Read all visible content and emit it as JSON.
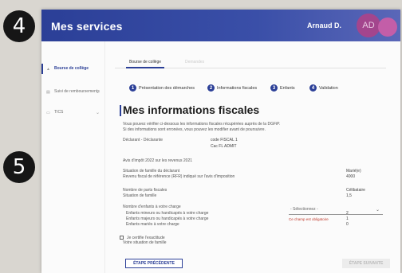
{
  "callouts": {
    "first": "4",
    "second": "5"
  },
  "header": {
    "title": "Mes services",
    "user_name": "Arnaud D.",
    "avatar_initials": "AD"
  },
  "sidebar": {
    "items": [
      {
        "label": "Bourse de collège",
        "icon": "graduation-cap-icon"
      },
      {
        "label": "Suivi de remboursements",
        "icon": "receipt-icon"
      },
      {
        "label": "TICS",
        "icon": "card-icon"
      }
    ]
  },
  "tabs": [
    {
      "label": "Bourse de collège"
    },
    {
      "label": "Demandes"
    }
  ],
  "stepper": [
    {
      "num": "1",
      "label": "Présentation des démarches"
    },
    {
      "num": "2",
      "label": "Informations fiscales"
    },
    {
      "num": "3",
      "label": "Enfants"
    },
    {
      "num": "4",
      "label": "Validation"
    }
  ],
  "main": {
    "title": "Mes informations fiscales",
    "intro_line1": "Vous pouvez vérifier ci-dessous les informations fiscales récupérées auprès de la DGFiP.",
    "intro_line2": "Si des informations sont erronées, vous pouvez les modifier avant de poursuivre.",
    "declarant_label": "Déclarant - Déclarante",
    "declarant_value1": "code FISCAL 1",
    "declarant_value2": "Cac FL ADMIT",
    "year_line": "Avis d'impôt 2022 sur les revenus 2021",
    "situation_label": "Situation de famille du déclarant",
    "situation_value": "Marié(e)",
    "income_label": "Revenu fiscal de référence (RFR) indiqué sur l'avis d'imposition",
    "income_value": "4000",
    "parts_label": "Nombre de parts fiscales",
    "parts_value": "Célibataire",
    "parts_detail": "Situation de famille",
    "parts_detail_value": "1,5",
    "children_label": "Nombre d'enfants à votre charge",
    "children_row1": "Enfants mineurs ou handicapés à votre charge",
    "children_row1_value": "2",
    "children_row2": "Enfants majeurs ou handicapés à votre charge",
    "children_row2_value": "1",
    "children_row3": "Enfants mariés à votre charge",
    "children_row3_value": "0",
    "select_label": "Votre situation de famille",
    "select_placeholder": "- Sélectionnez -",
    "select_error": "Ce champ est obligatoire",
    "checkbox_label": "Je certifie l'exactitude",
    "prev_button": "ÉTAPE PRÉCÉDENTE",
    "next_button": "ÉTAPE SUIVANTE"
  },
  "colors": {
    "brand": "#2b3f97",
    "avatar": "#a3458d",
    "error": "#c0392b"
  }
}
